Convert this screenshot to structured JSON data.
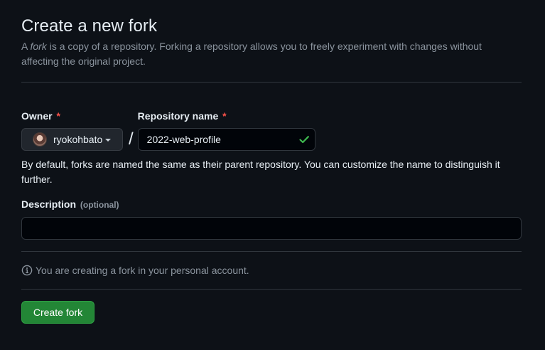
{
  "header": {
    "title": "Create a new fork",
    "subtitle_prefix": "A ",
    "subtitle_em": "fork",
    "subtitle_rest": " is a copy of a repository. Forking a repository allows you to freely experiment with changes without affecting the original project."
  },
  "form": {
    "owner": {
      "label": "Owner",
      "required_mark": "*",
      "value": "ryokohbato"
    },
    "separator": "/",
    "repo_name": {
      "label": "Repository name",
      "required_mark": "*",
      "value": "2022-web-profile",
      "valid": true
    },
    "name_hint": "By default, forks are named the same as their parent repository. You can customize the name to distinguish it further.",
    "description": {
      "label": "Description",
      "optional_label": "(optional)",
      "value": "",
      "placeholder": ""
    }
  },
  "notice": {
    "icon": "info-icon",
    "text": "You are creating a fork in your personal account."
  },
  "actions": {
    "create_label": "Create fork"
  },
  "colors": {
    "background": "#0d1117",
    "primary_button": "#238636",
    "required": "#f85149",
    "valid_check": "#3fb950"
  }
}
